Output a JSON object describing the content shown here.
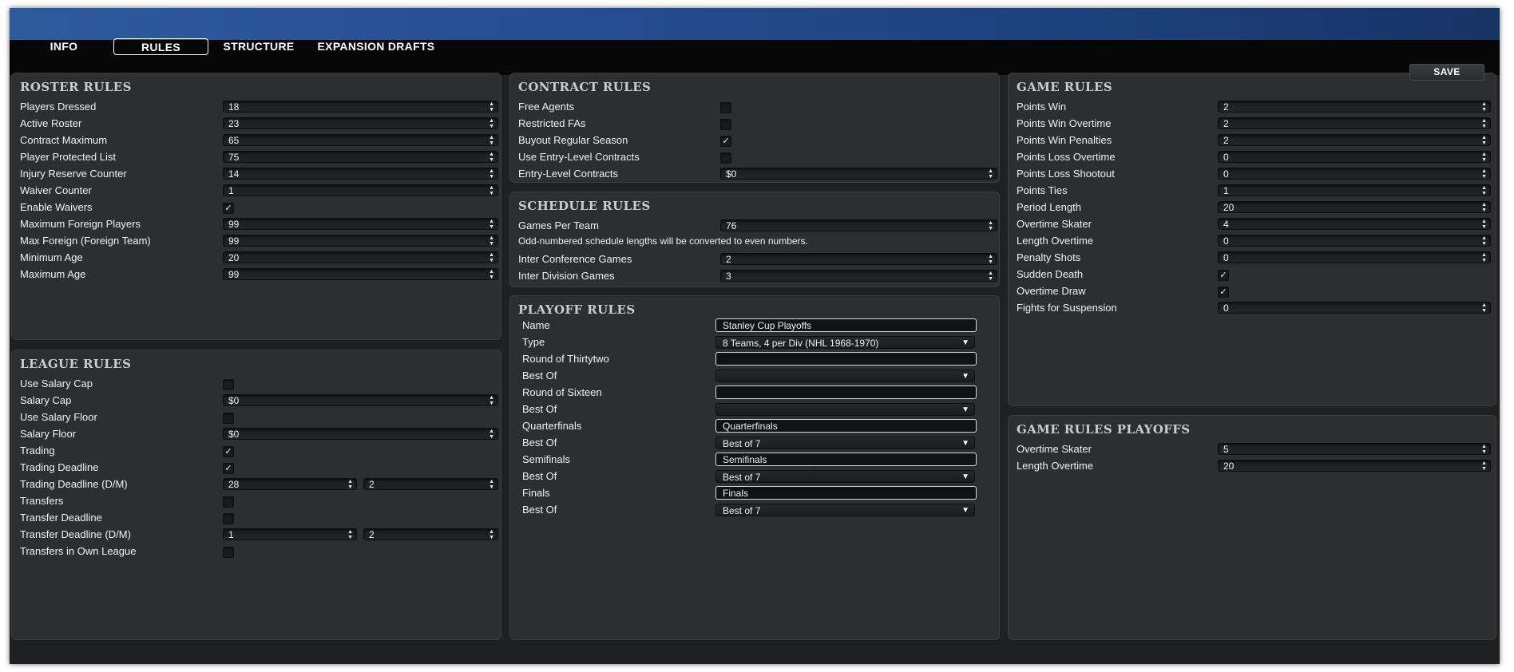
{
  "tabs": [
    {
      "label": "INFO"
    },
    {
      "label": "RULES"
    },
    {
      "label": "STRUCTURE"
    },
    {
      "label": "EXPANSION DRAFTS"
    }
  ],
  "save_label": "SAVE",
  "roster": {
    "title": "ROSTER RULES",
    "players_dressed": {
      "label": "Players Dressed",
      "value": "18"
    },
    "active_roster": {
      "label": "Active Roster",
      "value": "23"
    },
    "contract_max": {
      "label": "Contract Maximum",
      "value": "65"
    },
    "protected_list": {
      "label": "Player Protected List",
      "value": "75"
    },
    "injury_reserve": {
      "label": "Injury Reserve Counter",
      "value": "14"
    },
    "waiver_counter": {
      "label": "Waiver Counter",
      "value": "1"
    },
    "enable_waivers": {
      "label": "Enable Waivers",
      "checked": "✓"
    },
    "max_foreign": {
      "label": "Maximum Foreign Players",
      "value": "99"
    },
    "max_foreign_team": {
      "label": "Max Foreign (Foreign Team)",
      "value": "99"
    },
    "min_age": {
      "label": "Minimum Age",
      "value": "20"
    },
    "max_age": {
      "label": "Maximum Age",
      "value": "99"
    }
  },
  "league": {
    "title": "LEAGUE RULES",
    "use_salary_cap": {
      "label": "Use Salary Cap",
      "checked": ""
    },
    "salary_cap": {
      "label": "Salary Cap",
      "value": "$0"
    },
    "use_salary_floor": {
      "label": "Use Salary Floor",
      "checked": ""
    },
    "salary_floor": {
      "label": "Salary Floor",
      "value": "$0"
    },
    "trading": {
      "label": "Trading",
      "checked": "✓"
    },
    "trading_deadline": {
      "label": "Trading Deadline",
      "checked": "✓"
    },
    "trading_deadline_dm": {
      "label": "Trading Deadline (D/M)",
      "day": "28",
      "month": "2"
    },
    "transfers": {
      "label": "Transfers",
      "checked": ""
    },
    "transfer_deadline": {
      "label": "Transfer Deadline",
      "checked": ""
    },
    "transfer_deadline_dm": {
      "label": "Transfer Deadline (D/M)",
      "day": "1",
      "month": "2"
    },
    "transfers_own_league": {
      "label": "Transfers in Own League",
      "checked": ""
    }
  },
  "contract": {
    "title": "CONTRACT RULES",
    "free_agents": {
      "label": "Free Agents",
      "checked": ""
    },
    "restricted_fas": {
      "label": "Restricted FAs",
      "checked": ""
    },
    "buyout": {
      "label": "Buyout Regular Season",
      "checked": "✓"
    },
    "use_entry_level": {
      "label": "Use Entry-Level Contracts",
      "checked": ""
    },
    "entry_level": {
      "label": "Entry-Level Contracts",
      "value": "$0"
    }
  },
  "schedule": {
    "title": "SCHEDULE RULES",
    "games_per_team": {
      "label": "Games Per Team",
      "value": "76"
    },
    "note": "Odd-numbered schedule lengths will be converted to even numbers.",
    "inter_conference": {
      "label": "Inter Conference Games",
      "value": "2"
    },
    "inter_division": {
      "label": "Inter Division Games",
      "value": "3"
    }
  },
  "playoff": {
    "title": "PLAYOFF RULES",
    "name": {
      "label": "Name",
      "value": "Stanley Cup Playoffs"
    },
    "type": {
      "label": "Type",
      "value": "8 Teams, 4 per Div (NHL 1968-1970)"
    },
    "round32": {
      "label": "Round of Thirtytwo",
      "value": ""
    },
    "round32_best": {
      "label": "Best Of",
      "value": ""
    },
    "round16": {
      "label": "Round of Sixteen",
      "value": ""
    },
    "round16_best": {
      "label": "Best Of",
      "value": ""
    },
    "quarter": {
      "label": "Quarterfinals",
      "value": "Quarterfinals"
    },
    "quarter_best": {
      "label": "Best Of",
      "value": "Best of 7"
    },
    "semi": {
      "label": "Semifinals",
      "value": "Semifinals"
    },
    "semi_best": {
      "label": "Best Of",
      "value": "Best of 7"
    },
    "finals": {
      "label": "Finals",
      "value": "Finals"
    },
    "finals_best": {
      "label": "Best Of",
      "value": "Best of 7"
    }
  },
  "game": {
    "title": "GAME RULES",
    "points_win": {
      "label": "Points Win",
      "value": "2"
    },
    "points_win_ot": {
      "label": "Points Win Overtime",
      "value": "2"
    },
    "points_win_pen": {
      "label": "Points Win Penalties",
      "value": "2"
    },
    "points_loss_ot": {
      "label": "Points Loss Overtime",
      "value": "0"
    },
    "points_loss_so": {
      "label": "Points Loss Shootout",
      "value": "0"
    },
    "points_ties": {
      "label": "Points Ties",
      "value": "1"
    },
    "period_length": {
      "label": "Period Length",
      "value": "20"
    },
    "ot_skater": {
      "label": "Overtime Skater",
      "value": "4"
    },
    "length_ot": {
      "label": "Length Overtime",
      "value": "0"
    },
    "penalty_shots": {
      "label": "Penalty Shots",
      "value": "0"
    },
    "sudden_death": {
      "label": "Sudden Death",
      "checked": "✓"
    },
    "ot_draw": {
      "label": "Overtime Draw",
      "checked": "✓"
    },
    "fights": {
      "label": "Fights for Suspension",
      "value": "0"
    }
  },
  "game_playoffs": {
    "title": "GAME RULES PLAYOFFS",
    "ot_skater": {
      "label": "Overtime Skater",
      "value": "5"
    },
    "length_ot": {
      "label": "Length Overtime",
      "value": "20"
    }
  }
}
